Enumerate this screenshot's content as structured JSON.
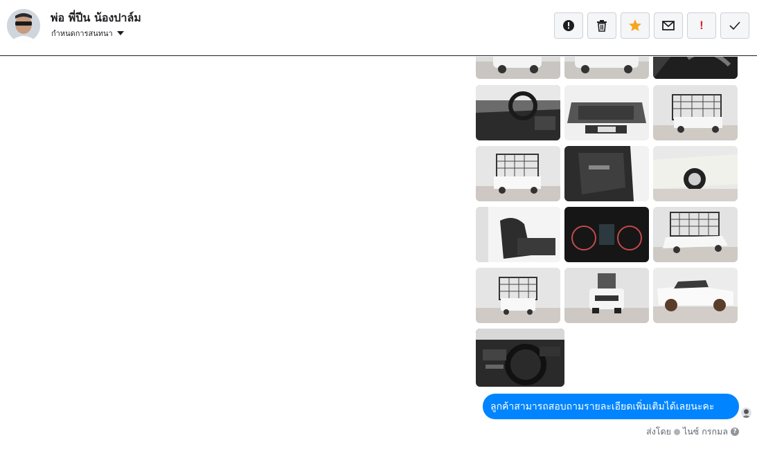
{
  "conversation": {
    "contact_name": "พ่อ พี่ปีน น้องปาล์ม",
    "assign_label": "กำหนดการสนทนา"
  },
  "toolbar": {
    "actions": [
      {
        "icon": "alert-circle-icon",
        "label": "spam"
      },
      {
        "icon": "trash-icon",
        "label": "delete"
      },
      {
        "icon": "star-icon",
        "label": "star"
      },
      {
        "icon": "envelope-icon",
        "label": "mark-unread"
      },
      {
        "icon": "exclamation-icon",
        "label": "follow-up"
      },
      {
        "icon": "checkmark-icon",
        "label": "done"
      }
    ],
    "star_color": "#f5a623",
    "follow_up_color": "#e02424"
  },
  "gallery": {
    "photo_count": 16,
    "photos": [
      "truck-exterior-front-partial",
      "truck-exterior-side-partial",
      "truck-interior-seat-partial",
      "truck-cabin-dashboard",
      "truck-engine-bay",
      "truck-rear-cage",
      "truck-rear-quarter-cage",
      "truck-door-open",
      "truck-wheel-closeup",
      "truck-front-seat",
      "truck-gauge-cluster",
      "truck-front-quarter-cage",
      "truck-rear-cage-center",
      "truck-front-center",
      "truck-side-no-cage",
      "truck-steering-wheel"
    ]
  },
  "message": {
    "text": "ลูกค้าสามารถสอบถามรายละเอียดเพิ่มเติมได้เลยนะคะ",
    "bubble_color": "#0084ff",
    "sent_by_prefix": "ส่งโดย",
    "sender_name": "ไนซ์ กรกมล",
    "help_glyph": "?"
  }
}
